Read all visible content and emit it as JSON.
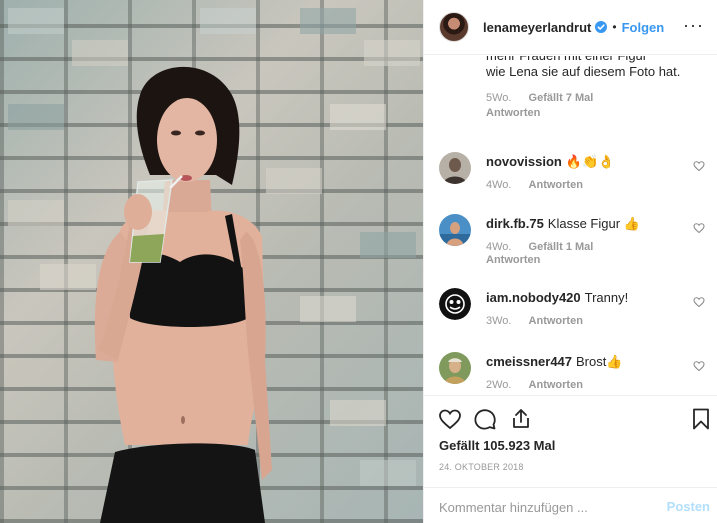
{
  "post": {
    "username": "lenameyerlandrut",
    "dot": "•",
    "follow_label": "Folgen",
    "more_icon": "more-options-icon"
  },
  "comments": {
    "first": {
      "text_clipped": "mehr Frauen mit einer Figur",
      "text": "wie Lena sie auf diesem Foto hat.",
      "time": "5Wo.",
      "likes": "Gefällt 7 Mal",
      "reply": "Antworten"
    },
    "items": [
      {
        "user": "novovission",
        "text": "🔥👏👌",
        "time": "4Wo.",
        "likes": "",
        "reply": "Antworten"
      },
      {
        "user": "dirk.fb.75",
        "text": "Klasse Figur 👍",
        "time": "4Wo.",
        "likes": "Gefällt 1 Mal",
        "reply": "Antworten"
      },
      {
        "user": "iam.nobody420",
        "text": "Tranny!",
        "time": "3Wo.",
        "likes": "",
        "reply": "Antworten"
      },
      {
        "user": "cmeissner447",
        "text": "Brost👍",
        "time": "2Wo.",
        "likes": "",
        "reply": "Antworten"
      }
    ]
  },
  "actions": {
    "like_icon": "heart-icon",
    "comment_icon": "comment-icon",
    "share_icon": "share-icon",
    "save_icon": "bookmark-icon"
  },
  "likes_text": "Gefällt 105.923 Mal",
  "date": "24. OKTOBER 2018",
  "add_comment": {
    "placeholder": "Kommentar hinzufügen ...",
    "post_label": "Posten"
  },
  "colors": {
    "link_blue": "#3897f0",
    "post_disabled": "#b2dffc",
    "muted_text": "#999999",
    "verified": "#3897f0"
  }
}
